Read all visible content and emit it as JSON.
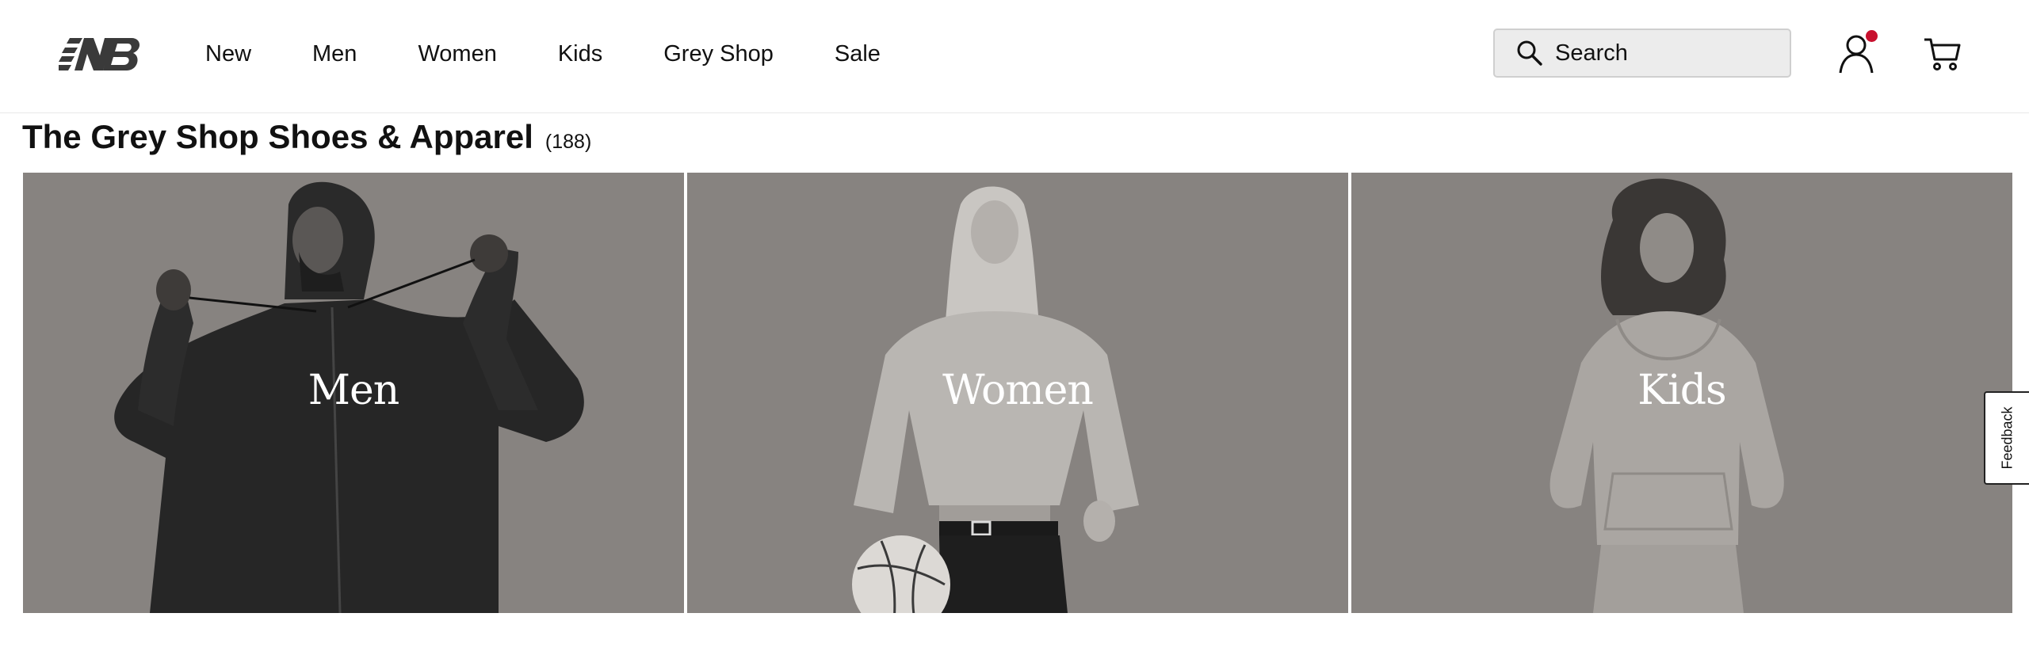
{
  "brand": {
    "logo_name": "new-balance-logo"
  },
  "nav": {
    "items": [
      {
        "label": "New"
      },
      {
        "label": "Men"
      },
      {
        "label": "Women"
      },
      {
        "label": "Kids"
      },
      {
        "label": "Grey Shop"
      },
      {
        "label": "Sale"
      }
    ]
  },
  "search": {
    "placeholder": "Search"
  },
  "account": {
    "icon": "user-icon",
    "notification_color": "#c8102e"
  },
  "cart": {
    "icon": "cart-icon"
  },
  "page": {
    "title": "The Grey Shop Shoes & Apparel",
    "count": "(188)"
  },
  "tiles": [
    {
      "label": "Men"
    },
    {
      "label": "Women"
    },
    {
      "label": "Kids"
    }
  ],
  "feedback": {
    "label": "Feedback"
  },
  "colors": {
    "tile_background": "#878380",
    "text": "#111111",
    "search_background": "#ececec"
  }
}
